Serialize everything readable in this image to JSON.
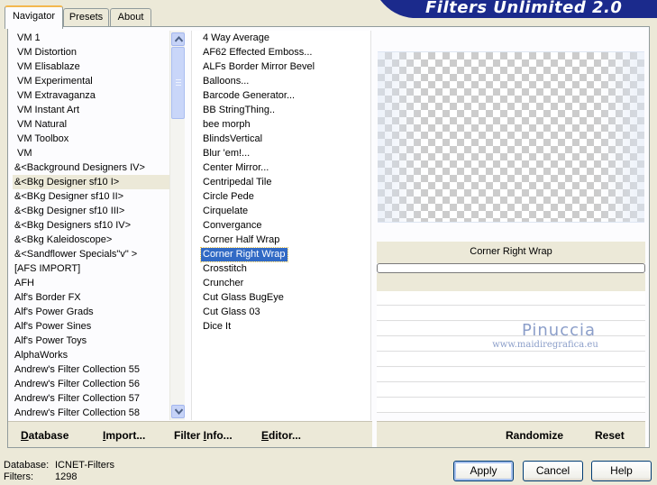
{
  "tabs": [
    "Navigator",
    "Presets",
    "About"
  ],
  "app_title": "Filters Unlimited 2.0",
  "categories": [
    "VM 1",
    "VM Distortion",
    "VM Elisablaze",
    "VM Experimental",
    "VM Extravaganza",
    "VM Instant Art",
    "VM Natural",
    "VM Toolbox",
    "VM",
    "&<Background Designers IV>",
    "&<Bkg Designer sf10 I>",
    "&<BKg Designer sf10 II>",
    "&<Bkg Designer sf10 III>",
    "&<Bkg Designers sf10 IV>",
    "&<Bkg Kaleidoscope>",
    "&<Sandflower Specials\"v\" >",
    "[AFS IMPORT]",
    "AFH",
    "Alf's Border FX",
    "Alf's Power Grads",
    "Alf's Power Sines",
    "Alf's Power Toys",
    "AlphaWorks",
    "Andrew's Filter Collection 55",
    "Andrew's Filter Collection 56",
    "Andrew's Filter Collection 57",
    "Andrew's Filter Collection 58"
  ],
  "selected_category": "&<Bkg Designer sf10 I>",
  "filters": [
    "4 Way Average",
    "AF62 Effected Emboss...",
    "ALFs Border Mirror Bevel",
    "Balloons...",
    "Barcode Generator...",
    "BB StringThing..",
    "bee morph",
    "BlindsVertical",
    "Blur 'em!...",
    "Center Mirror...",
    "Centripedal Tile",
    "Circle Pede",
    "Cirquelate",
    "Convergance",
    "Corner Half Wrap",
    "Corner Right Wrap",
    "Crosstitch",
    "Cruncher",
    "Cut Glass  BugEye",
    "Cut Glass 03",
    "Dice It"
  ],
  "selected_filter": "Corner Right Wrap",
  "filter_name_display": "Corner Right Wrap",
  "watermark": {
    "name": "Pinuccia",
    "url": "www.maidiregrafica.eu"
  },
  "left_toolbar": [
    {
      "pre": "",
      "ul": "D",
      "post": "atabase"
    },
    {
      "pre": "",
      "ul": "I",
      "post": "mport..."
    },
    {
      "pre": "Filter ",
      "ul": "I",
      "post": "nfo..."
    },
    {
      "pre": "",
      "ul": "E",
      "post": "ditor..."
    }
  ],
  "right_toolbar": {
    "randomize": "Randomize",
    "reset": "Reset"
  },
  "status": {
    "database_label": "Database:",
    "database_value": "ICNET-Filters",
    "filters_label": "Filters:",
    "filters_value": "1298"
  },
  "dialog_buttons": {
    "apply": "Apply",
    "cancel": "Cancel",
    "help": "Help"
  },
  "colors": {
    "selection": "#316ac5",
    "banner": "#1b2a8c",
    "panel": "#ece9d8"
  }
}
